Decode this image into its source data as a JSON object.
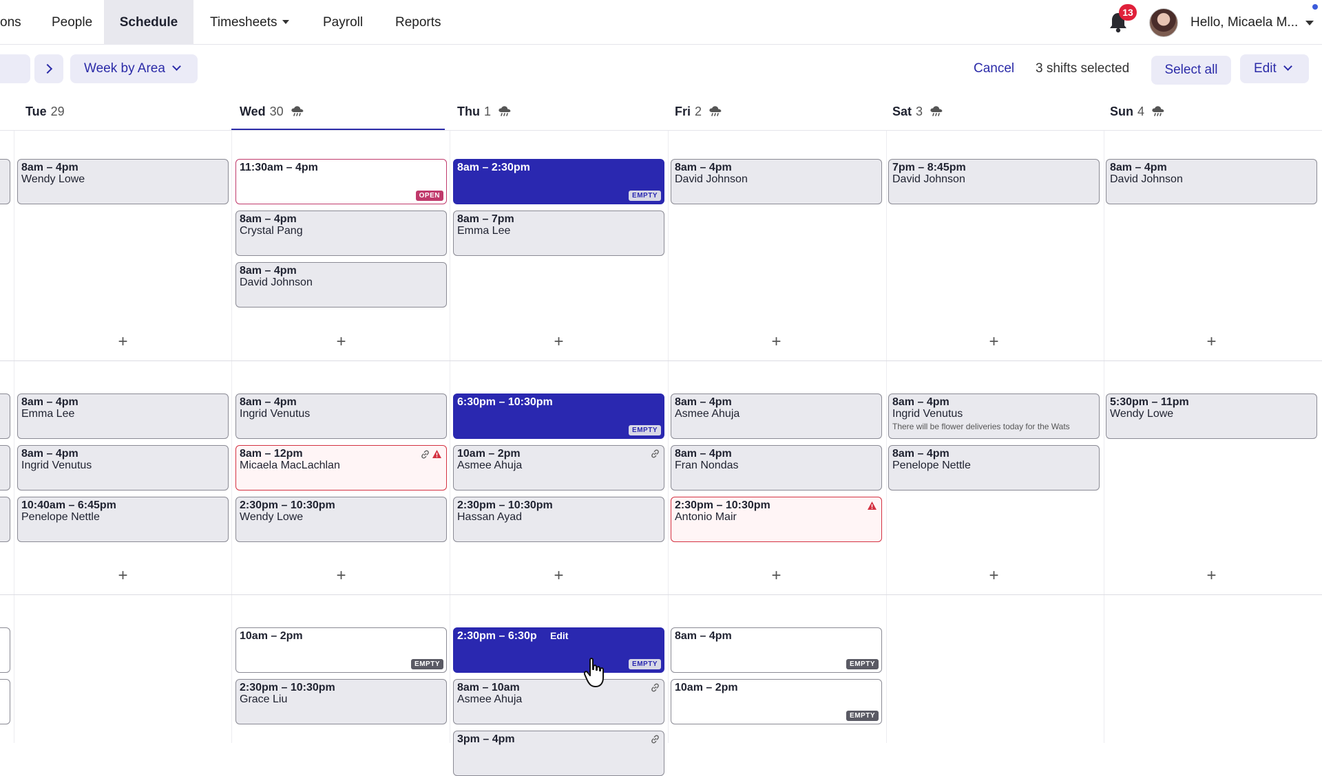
{
  "nav": {
    "items": [
      {
        "label": "ons"
      },
      {
        "label": "People"
      },
      {
        "label": "Schedule"
      },
      {
        "label": "Timesheets"
      },
      {
        "label": "Payroll"
      },
      {
        "label": "Reports"
      }
    ],
    "notification_count": "13",
    "greeting": "Hello, Micaela M..."
  },
  "toolbar": {
    "view_label": "Week by Area",
    "cancel_label": "Cancel",
    "selected_text": "3 shifts selected",
    "select_all_label": "Select all",
    "edit_label": "Edit"
  },
  "days": [
    {
      "name": "Tue",
      "num": "29"
    },
    {
      "name": "Wed",
      "num": "30"
    },
    {
      "name": "Thu",
      "num": "1"
    },
    {
      "name": "Fri",
      "num": "2"
    },
    {
      "name": "Sat",
      "num": "3"
    },
    {
      "name": "Sun",
      "num": "4"
    }
  ],
  "areas": [
    {
      "columns": [
        [
          {
            "time": "8am – 4pm",
            "name": "Wendy Lowe"
          }
        ],
        [
          {
            "time": "11:30am – 4pm",
            "name": "",
            "tag": "OPEN"
          },
          {
            "time": "8am – 4pm",
            "name": "Crystal Pang"
          },
          {
            "time": "8am – 4pm",
            "name": "David Johnson"
          }
        ],
        [
          {
            "time": "8am – 2:30pm",
            "name": "",
            "tag": "EMPTY",
            "selected": true
          },
          {
            "time": "8am – 7pm",
            "name": "Emma Lee"
          }
        ],
        [
          {
            "time": "8am – 4pm",
            "name": "David Johnson"
          }
        ],
        [
          {
            "time": "7pm – 8:45pm",
            "name": "David Johnson"
          }
        ],
        [
          {
            "time": "8am – 4pm",
            "name": "David Johnson"
          }
        ]
      ]
    },
    {
      "columns": [
        [
          {
            "time": "8am – 4pm",
            "name": "Emma Lee"
          },
          {
            "time": "8am – 4pm",
            "name": "Ingrid Venutus"
          },
          {
            "time": "10:40am – 6:45pm",
            "name": "Penelope Nettle"
          }
        ],
        [
          {
            "time": "8am – 4pm",
            "name": "Ingrid Venutus"
          },
          {
            "time": "8am – 12pm",
            "name": "Micaela MacLachlan",
            "warning": true,
            "linked": true
          },
          {
            "time": "2:30pm – 10:30pm",
            "name": "Wendy Lowe"
          }
        ],
        [
          {
            "time": "6:30pm – 10:30pm",
            "name": "",
            "tag": "EMPTY",
            "selected": true
          },
          {
            "time": "10am – 2pm",
            "name": "Asmee Ahuja",
            "linked": true
          },
          {
            "time": "2:30pm – 10:30pm",
            "name": "Hassan Ayad"
          }
        ],
        [
          {
            "time": "8am – 4pm",
            "name": "Asmee Ahuja"
          },
          {
            "time": "8am – 4pm",
            "name": "Fran Nondas"
          },
          {
            "time": "2:30pm – 10:30pm",
            "name": "Antonio Mair",
            "warning": true
          }
        ],
        [
          {
            "time": "8am – 4pm",
            "name": "Ingrid Venutus",
            "note": "There will be flower deliveries today for the Wats"
          },
          {
            "time": "8am – 4pm",
            "name": "Penelope Nettle"
          }
        ],
        [
          {
            "time": "5:30pm – 11pm",
            "name": "Wendy Lowe"
          }
        ]
      ]
    },
    {
      "columns": [
        [],
        [
          {
            "time": "10am – 2pm",
            "name": "",
            "tag": "EMPTY"
          },
          {
            "time": "2:30pm – 10:30pm",
            "name": "Grace Liu"
          }
        ],
        [
          {
            "time": "2:30pm – 6:30p",
            "name": "",
            "tag": "EMPTY",
            "selected": true,
            "hover_label": "Edit"
          },
          {
            "time": "8am – 10am",
            "name": "Asmee Ahuja",
            "linked": true
          },
          {
            "time": "3pm – 4pm",
            "name": "",
            "linked": true
          }
        ],
        [
          {
            "time": "8am – 4pm",
            "name": "",
            "tag": "EMPTY"
          },
          {
            "time": "10am – 2pm",
            "name": "",
            "tag": "EMPTY"
          }
        ],
        [],
        []
      ]
    }
  ],
  "icons": {
    "bell": "bell-icon",
    "weather": "rain-cloud-icon",
    "link": "link-icon",
    "warning": "warning-icon",
    "add": "plus-icon",
    "cursor": "hand-pointer-icon"
  },
  "colors": {
    "accent": "#2b2ba8",
    "selected_shift": "#2a28b0",
    "open_tag": "#c0396b",
    "warning": "#d43040",
    "badge": "#e0203a"
  }
}
